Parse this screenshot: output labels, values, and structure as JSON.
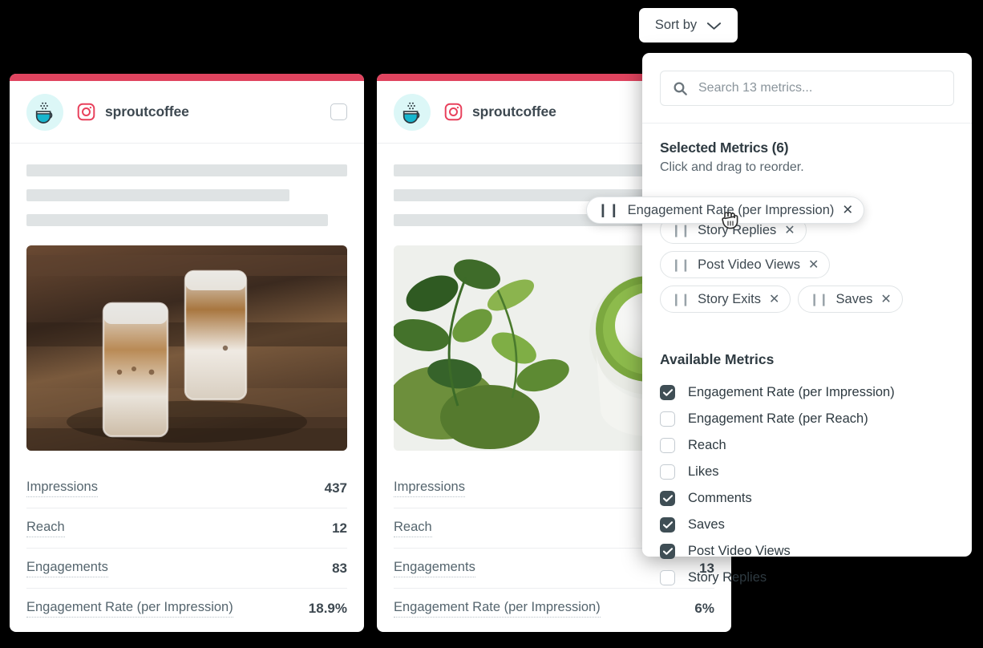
{
  "theme": {
    "page_background": "#000000",
    "card_accent": "#e0445f",
    "avatar_background": "#dcf7f7",
    "instagram_icon_color": "#e8415c",
    "checkbox_checked": "#3f4e55",
    "text_primary": "#3d4850",
    "text_muted": "#5a666e"
  },
  "sort_button": {
    "label": "Sort by",
    "chevron_icon": "chevron-down-icon"
  },
  "panel": {
    "search": {
      "icon": "search-icon",
      "placeholder": "Search 13 metrics...",
      "value": ""
    },
    "selected_heading": "Selected Metrics (6)",
    "selected_subtext": "Click and drag to reorder.",
    "dragging_chip": {
      "label": "Engagement Rate (per Impression)",
      "grip_icon": "drag-handle-icon",
      "remove_icon": "close-icon",
      "cursor_icon": "grabbing-hand-cursor"
    },
    "chips": [
      {
        "label": "Story Replies",
        "grip_icon": "drag-handle-icon",
        "remove_icon": "close-icon"
      },
      {
        "label": "Post Video Views",
        "grip_icon": "drag-handle-icon",
        "remove_icon": "close-icon"
      },
      {
        "label": "Story Exits",
        "grip_icon": "drag-handle-icon",
        "remove_icon": "close-icon"
      },
      {
        "label": "Saves",
        "grip_icon": "drag-handle-icon",
        "remove_icon": "close-icon"
      }
    ],
    "available_heading": "Available Metrics",
    "available_metrics": [
      {
        "label": "Engagement Rate (per Impression)",
        "checked": true
      },
      {
        "label": "Engagement Rate (per Reach)",
        "checked": false
      },
      {
        "label": "Reach",
        "checked": false
      },
      {
        "label": "Likes",
        "checked": false
      },
      {
        "label": "Comments",
        "checked": true
      },
      {
        "label": "Saves",
        "checked": true
      },
      {
        "label": "Post Video Views",
        "checked": true
      },
      {
        "label": "Story Replies",
        "checked": false
      }
    ]
  },
  "cards": [
    {
      "handle": "sproutcoffee",
      "network_icon": "instagram-icon",
      "avatar_icon": "coffee-cup-icon",
      "select_checkbox": {
        "checked": false
      },
      "image_alt": "two iced lattes in glass jars on a wooden table",
      "skeleton_widths": [
        "100%",
        "82%",
        "94%"
      ],
      "metrics": [
        {
          "label": "Impressions",
          "value": "437"
        },
        {
          "label": "Reach",
          "value": "12"
        },
        {
          "label": "Engagements",
          "value": "83"
        },
        {
          "label": "Engagement Rate (per Impression)",
          "value": "18.9%"
        }
      ]
    },
    {
      "handle": "sproutcoffee",
      "network_icon": "instagram-icon",
      "avatar_icon": "coffee-cup-icon",
      "select_checkbox": {
        "checked": false
      },
      "image_alt": "matcha latte beside a potted trailing plant",
      "skeleton_widths": [
        "100%",
        "82%",
        "94%"
      ],
      "metrics": [
        {
          "label": "Impressions",
          "value": ""
        },
        {
          "label": "Reach",
          "value": ""
        },
        {
          "label": "Engagements",
          "value": "13"
        },
        {
          "label": "Engagement Rate (per Impression)",
          "value": "6%"
        }
      ]
    }
  ]
}
